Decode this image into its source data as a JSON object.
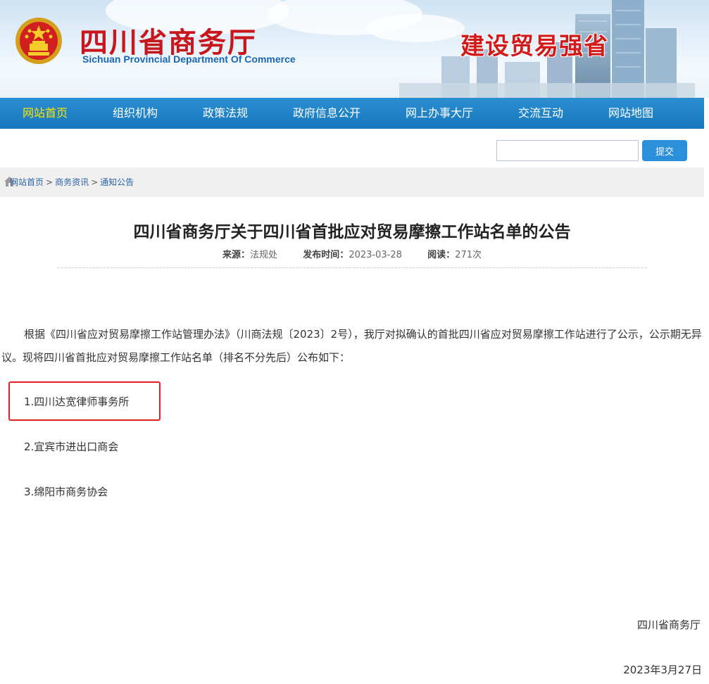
{
  "header": {
    "site_title": "四川省商务厅",
    "site_subtitle": "Sichuan Provincial Department Of Commerce",
    "slogan": "建设贸易强省"
  },
  "nav": {
    "items": [
      {
        "label": "网站首页",
        "active": true
      },
      {
        "label": "组织机构",
        "active": false
      },
      {
        "label": "政策法规",
        "active": false
      },
      {
        "label": "政府信息公开",
        "active": false
      },
      {
        "label": "网上办事大厅",
        "active": false
      },
      {
        "label": "交流互动",
        "active": false
      },
      {
        "label": "网站地图",
        "active": false
      }
    ],
    "active_color": "#ffe400",
    "bar_color": "#1e83c8"
  },
  "search": {
    "value": "",
    "button_label": "提交"
  },
  "breadcrumb": {
    "items": [
      "网站首页",
      "商务资讯",
      "通知公告"
    ],
    "separator": ">"
  },
  "article": {
    "title": "四川省商务厅关于四川省首批应对贸易摩擦工作站名单的公告",
    "source_label": "来源：",
    "source": "法规处",
    "date_label": "发布时间：",
    "date": "2023-03-28",
    "reads_label": "阅读：",
    "reads": "271次",
    "intro": "根据《四川省应对贸易摩擦工作站管理办法》（川商法规〔2023〕2号），我厅对拟确认的首批四川省应对贸易摩擦工作站进行了公示，公示期无异议。现将四川省首批应对贸易摩擦工作站名单（排名不分先后）公布如下：",
    "list": [
      "1.四川达宽律师事务所",
      "2.宜宾市进出口商会",
      "3.绵阳市商务协会"
    ],
    "signature": "四川省商务厅",
    "sign_date": "2023年3月27日"
  }
}
